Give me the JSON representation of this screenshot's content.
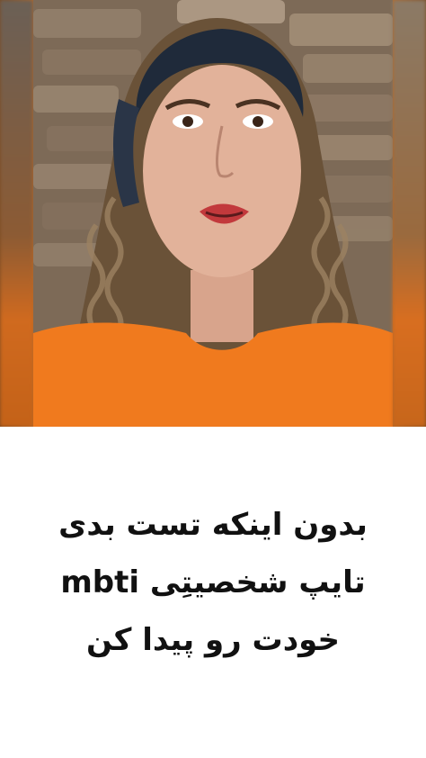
{
  "caption": {
    "lines": [
      "بدون اینکه تست بدی",
      "تایپ شخصیتِی mbti",
      "خودت رو پیدا کن"
    ]
  }
}
